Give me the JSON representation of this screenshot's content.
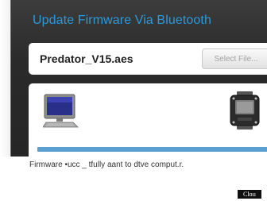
{
  "dialog": {
    "title": "Update Firmware Via Bluetooth"
  },
  "file_row": {
    "file_name": "Predator_V15.aes",
    "select_button_label": "Select File..."
  },
  "transfer": {
    "source_icon": "computer-icon",
    "target_icon": "device-icon",
    "progress_fraction": 1.0
  },
  "status": {
    "message": "Firmware •ucc _ tfully aant to dtve comput.r."
  },
  "footer": {
    "close_label": "Cloıı"
  },
  "colors": {
    "title_blue": "#2f98d8",
    "progress_blue": "#5a9fd0",
    "dialog_background": "#2a2a2a"
  }
}
